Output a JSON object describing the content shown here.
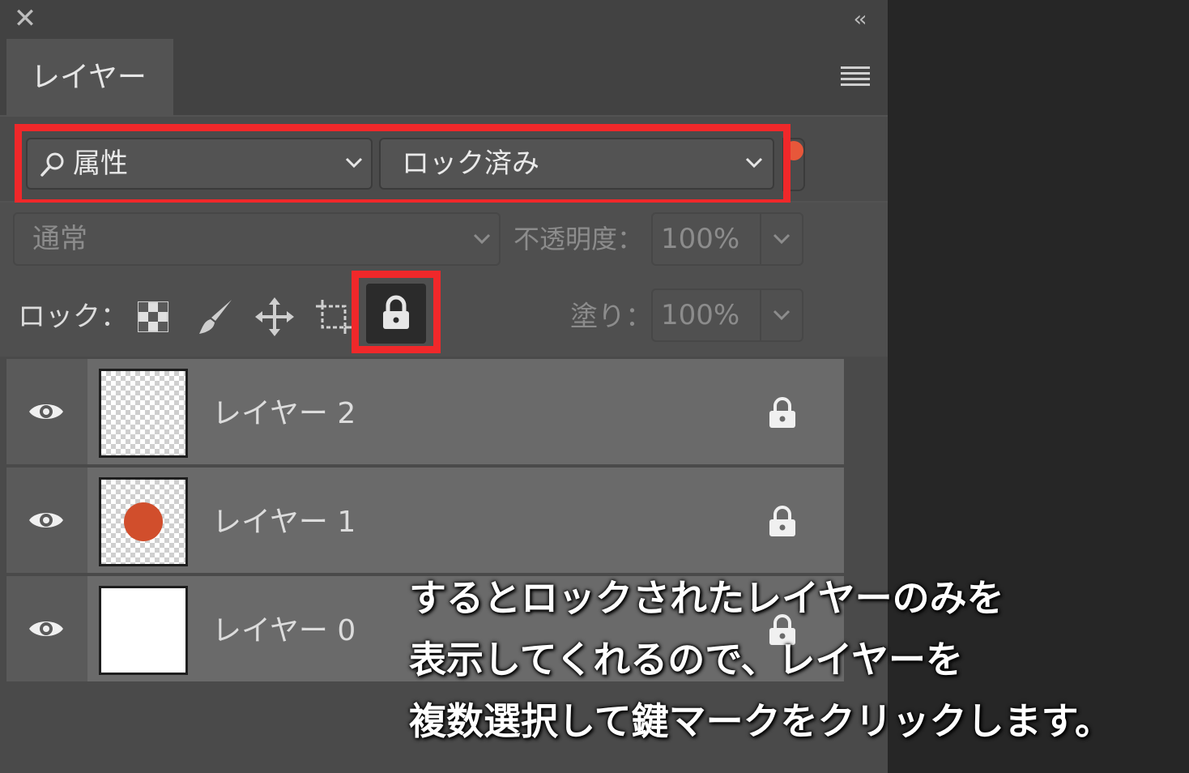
{
  "window": {
    "close_icon": "close-icon",
    "collapse_glyph": "‹‹"
  },
  "panel": {
    "tab_label": "レイヤー"
  },
  "filter": {
    "type_label": "属性",
    "value_label": "ロック済み"
  },
  "blend": {
    "mode_label": "通常",
    "opacity_label": "不透明度：",
    "opacity_value": "100%"
  },
  "lock": {
    "label": "ロック：",
    "fill_label": "塗り：",
    "fill_value": "100%"
  },
  "layers": [
    {
      "name": "レイヤー 2",
      "thumb": "transparent"
    },
    {
      "name": "レイヤー 1",
      "thumb": "orange-dot"
    },
    {
      "name": "レイヤー 0",
      "thumb": "white"
    }
  ],
  "caption": {
    "line1": "するとロックされたレイヤーのみを",
    "line2": "表示してくれるので、レイヤーを",
    "line3": "複数選択して鍵マークをクリックします。"
  },
  "colors": {
    "highlight": "#f0282a",
    "accent": "#e7573a",
    "panel": "#535353"
  }
}
